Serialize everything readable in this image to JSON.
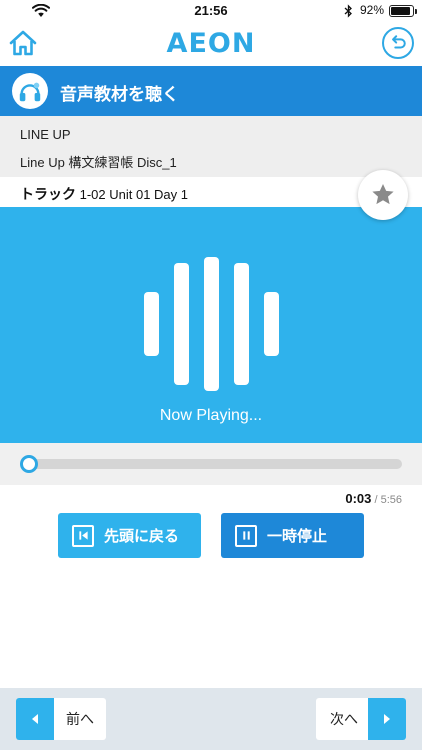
{
  "status_bar": {
    "time": "21:56",
    "battery": "92%",
    "battery_level": 0.92
  },
  "header": {
    "logo": "AEON"
  },
  "title_bar": {
    "title": "音声教材を聴く"
  },
  "info": {
    "series": "LINE UP",
    "disc": "Line Up 構文練習帳 Disc_1"
  },
  "track": {
    "label": "トラック",
    "detail": " 1-02 Unit 01 Day 1"
  },
  "player": {
    "status": "Now Playing..."
  },
  "progress": {
    "current": "0:03",
    "separator": " / ",
    "total": "5:56",
    "fraction": 0.0084
  },
  "controls": {
    "restart_label": "先頭に戻る",
    "pause_label": "一時停止"
  },
  "footer": {
    "prev_label": "前へ",
    "next_label": "次へ"
  },
  "colors": {
    "accent": "#2ea8e4",
    "header_blue": "#1e88d8",
    "player_blue": "#2fb2ec"
  },
  "icons": [
    "wifi-icon",
    "bluetooth-icon",
    "battery-icon",
    "home-icon",
    "return-icon",
    "headphones-icon",
    "star-icon",
    "sound-wave-icon",
    "skip-start-icon",
    "pause-icon",
    "arrow-left-icon",
    "arrow-right-icon"
  ]
}
